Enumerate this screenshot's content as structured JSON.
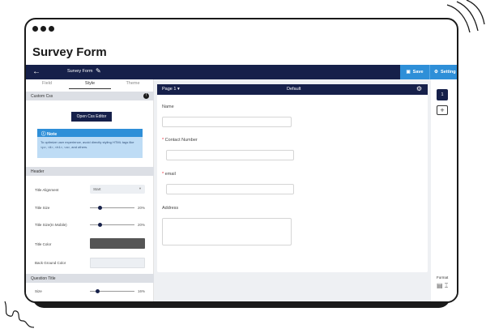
{
  "window": {
    "title": "Survey Form"
  },
  "topbar": {
    "back_icon": "arrow-left-icon",
    "form_name": "Survey Form",
    "edit_icon": "pencil-icon",
    "save_label": "Save",
    "settings_label": "Setting"
  },
  "left_panel": {
    "tabs": [
      {
        "label": "Field"
      },
      {
        "label": "Style",
        "active": true
      },
      {
        "label": "Theme"
      }
    ],
    "custom_css": {
      "section_label": "Custom Css",
      "button_label": "Open Css Editor",
      "note_title": "Note",
      "note_text": "To optimize user experience, avoid directly styling HTML tags like <p>, <li>, <h1>, <a>, and others."
    },
    "header_section": {
      "label": "Header",
      "title_alignment": {
        "label": "Title Alignment",
        "value": "Start"
      },
      "title_size": {
        "label": "Title Size",
        "value": 20,
        "display": "20%"
      },
      "title_size_mobile": {
        "label": "Title Size(In Mobile)",
        "value": 20,
        "display": "20%"
      },
      "title_color": {
        "label": "Title Color",
        "color": "#555555"
      },
      "background_color": {
        "label": "Back Ground Color",
        "color": "#eceff3"
      }
    },
    "question_title_section": {
      "label": "Question Title",
      "size": {
        "label": "Size",
        "value": 16,
        "display": "16%"
      }
    }
  },
  "canvas": {
    "page_select": "Page 1",
    "page_name": "Default",
    "fields": [
      {
        "label": "Name",
        "required": false
      },
      {
        "label": "Contact Number",
        "required": true
      },
      {
        "label": "email",
        "required": true
      },
      {
        "label": "Address",
        "required": false
      }
    ]
  },
  "right_rail": {
    "page_number": "1",
    "add_label": "+",
    "format_label": "Format"
  },
  "colors": {
    "navy": "#16204a",
    "accent_blue": "#2e8fd8",
    "required_red": "#ee2233"
  }
}
